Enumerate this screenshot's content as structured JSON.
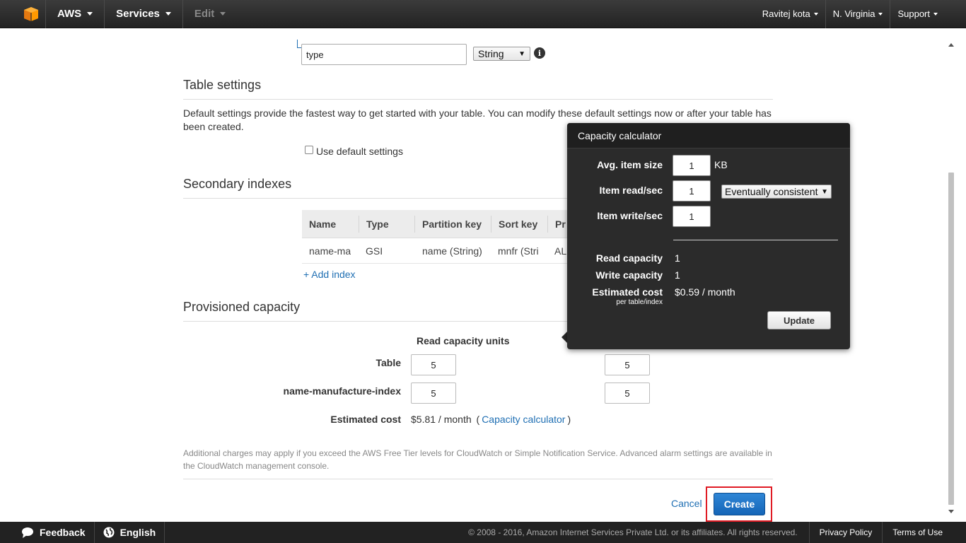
{
  "nav": {
    "aws_label": "AWS",
    "services_label": "Services",
    "edit_label": "Edit",
    "user_label": "Ravitej kota",
    "region_label": "N. Virginia",
    "support_label": "Support"
  },
  "sort_key": {
    "value": "type",
    "type_selected": "String"
  },
  "table_settings": {
    "title": "Table settings",
    "description": "Default settings provide the fastest way to get started with your table. You can modify these default settings now or after your table has been created.",
    "default_checkbox_label": "Use default settings"
  },
  "secondary_indexes": {
    "title": "Secondary indexes",
    "columns": [
      "Name",
      "Type",
      "Partition key",
      "Sort key",
      "Pr"
    ],
    "rows": [
      [
        "name-ma",
        "GSI",
        "name (String)",
        "mnfr (Stri",
        "AL"
      ]
    ],
    "add_index_label": "+ Add index"
  },
  "provisioned_capacity": {
    "title": "Provisioned capacity",
    "read_units_header": "Read capacity units",
    "rows": [
      {
        "label": "Table",
        "read": "5",
        "write": "5"
      },
      {
        "label": "name-manufacture-index",
        "read": "5",
        "write": "5"
      }
    ],
    "estimated_cost_label": "Estimated cost",
    "estimated_cost_value": "$5.81 / month",
    "calc_open_paren": "(",
    "calc_link": "Capacity calculator",
    "calc_close_paren": ")"
  },
  "footnote": "Additional charges may apply if you exceed the AWS Free Tier levels for CloudWatch or Simple Notification Service. Advanced alarm settings are available in the CloudWatch management console.",
  "actions": {
    "cancel_label": "Cancel",
    "create_label": "Create"
  },
  "calculator": {
    "title": "Capacity calculator",
    "avg_item_size_label": "Avg. item size",
    "avg_item_size_value": "1",
    "avg_item_size_unit": "KB",
    "item_read_label": "Item read/sec",
    "item_read_value": "1",
    "consistency_selected": "Eventually consistent",
    "item_write_label": "Item write/sec",
    "item_write_value": "1",
    "read_capacity_label": "Read capacity",
    "read_capacity_value": "1",
    "write_capacity_label": "Write capacity",
    "write_capacity_value": "1",
    "estimated_cost_label": "Estimated cost",
    "estimated_cost_sub": "per table/index",
    "estimated_cost_value": "$0.59 / month",
    "update_label": "Update"
  },
  "footer": {
    "feedback_label": "Feedback",
    "language_label": "English",
    "copyright": "© 2008 - 2016, Amazon Internet Services Private Ltd. or its affiliates. All rights reserved.",
    "privacy_label": "Privacy Policy",
    "terms_label": "Terms of Use"
  },
  "colors": {
    "nav_bg": "#2b2b2b",
    "link": "#1f6fb3",
    "primary_button": "#1a73c4",
    "highlight": "#e01b24",
    "popover_bg": "#2b2b2b"
  },
  "icons": [
    "aws-cube-icon",
    "info-icon",
    "speech-bubble-icon",
    "globe-icon"
  ]
}
